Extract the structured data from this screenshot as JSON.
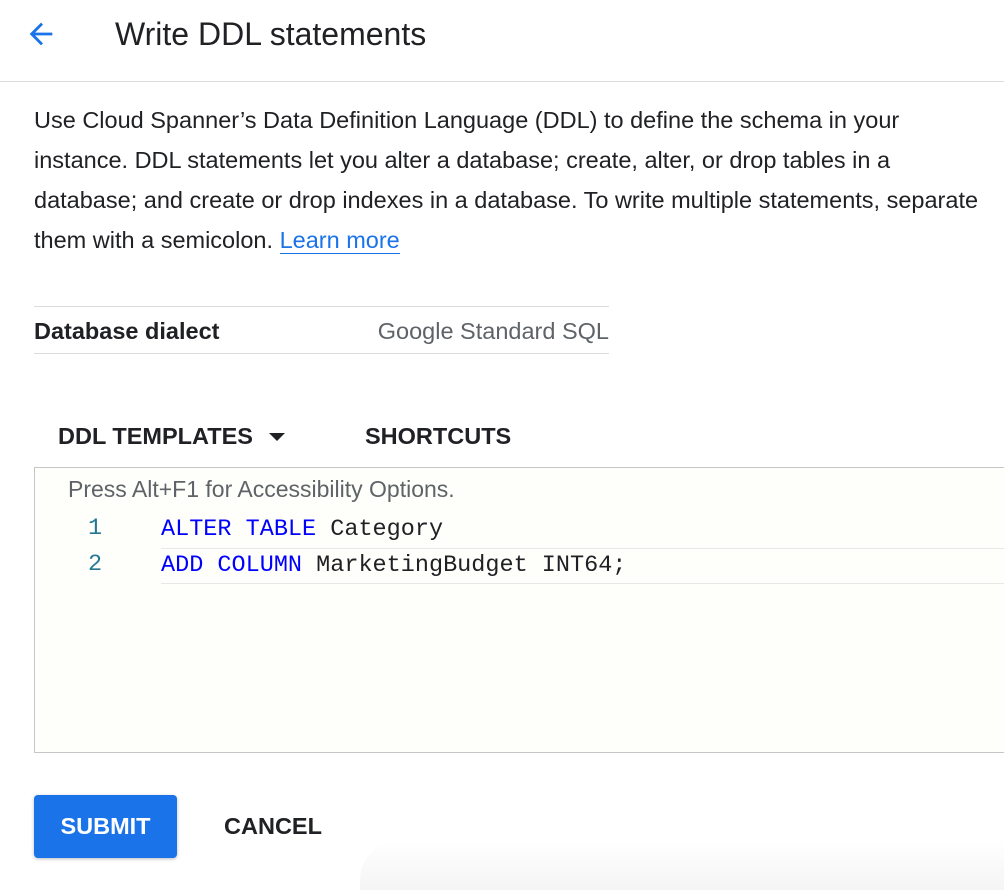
{
  "header": {
    "back_icon": "arrow-back-icon",
    "title": "Write DDL statements"
  },
  "intro": {
    "text": "Use Cloud Spanner’s Data Definition Language (DDL) to define the schema in your instance. DDL statements let you alter a database; create, alter, or drop tables in a database; and create or drop indexes in a database. To write multiple statements, separate them with a semicolon.",
    "learn_more": "Learn more"
  },
  "dialect": {
    "label": "Database dialect",
    "value": "Google Standard SQL"
  },
  "toolbar": {
    "ddl_templates": "DDL TEMPLATES",
    "shortcuts": "SHORTCUTS"
  },
  "editor": {
    "accessibility_hint": "Press Alt+F1 for Accessibility Options.",
    "lines": [
      {
        "number": "1",
        "tokens": [
          {
            "text": "ALTER",
            "kind": "keyword"
          },
          {
            "text": " ",
            "kind": "plain"
          },
          {
            "text": "TABLE",
            "kind": "keyword"
          },
          {
            "text": " Category",
            "kind": "plain"
          }
        ]
      },
      {
        "number": "2",
        "tokens": [
          {
            "text": "ADD",
            "kind": "keyword"
          },
          {
            "text": " ",
            "kind": "plain"
          },
          {
            "text": "COLUMN",
            "kind": "keyword"
          },
          {
            "text": " MarketingBudget INT64;",
            "kind": "plain"
          }
        ]
      }
    ]
  },
  "actions": {
    "submit": "SUBMIT",
    "cancel": "CANCEL"
  },
  "colors": {
    "accent": "#1a73e8",
    "keyword": "#0000ff",
    "line_number": "#237893"
  }
}
